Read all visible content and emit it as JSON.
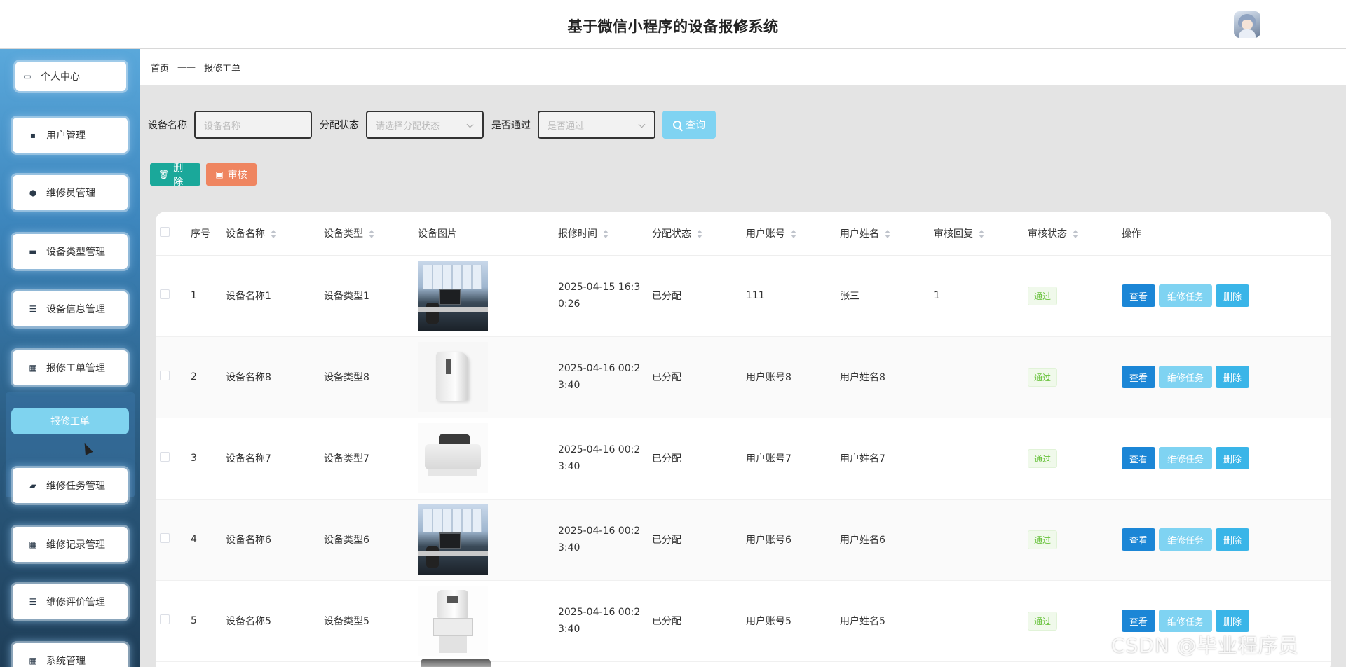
{
  "header": {
    "title": "基于微信小程序的设备报修系统"
  },
  "sidebar": {
    "items": [
      {
        "label": "个人中心",
        "icon": "card-icon"
      },
      {
        "label": "用户管理",
        "icon": "chat-icon"
      },
      {
        "label": "维修员管理",
        "icon": "pin-icon"
      },
      {
        "label": "设备类型管理",
        "icon": "monitor-icon"
      },
      {
        "label": "设备信息管理",
        "icon": "list-icon"
      },
      {
        "label": "报修工单管理",
        "icon": "grid-icon"
      },
      {
        "label": "维修任务管理",
        "icon": "wallet-icon"
      },
      {
        "label": "维修记录管理",
        "icon": "grid-icon"
      },
      {
        "label": "维修评价管理",
        "icon": "list-icon"
      },
      {
        "label": "系统管理",
        "icon": "grid-icon"
      }
    ],
    "active_sub": "报修工单"
  },
  "breadcrumb": {
    "home": "首页",
    "sep": "——",
    "current": "报修工单"
  },
  "search": {
    "device_name_label": "设备名称",
    "device_name_placeholder": "设备名称",
    "assign_label": "分配状态",
    "assign_placeholder": "请选择分配状态",
    "pass_label": "是否通过",
    "pass_placeholder": "是否通过",
    "query_label": "查询"
  },
  "actions": {
    "delete_label": "删除",
    "audit_label": "审核"
  },
  "table": {
    "headers": {
      "index": "序号",
      "device_name": "设备名称",
      "device_type": "设备类型",
      "device_image": "设备图片",
      "report_time": "报修时间",
      "assign_status": "分配状态",
      "user_account": "用户账号",
      "user_name": "用户姓名",
      "audit_reply": "审核回复",
      "audit_status": "审核状态",
      "operations": "操作"
    },
    "op_labels": {
      "view": "查看",
      "task": "维修任务",
      "delete": "删除"
    },
    "rows": [
      {
        "index": "1",
        "device_name": "设备名称1",
        "device_type": "设备类型1",
        "image": "office",
        "report_time": "2025-04-15 16:30:26",
        "assign_status": "已分配",
        "user_account": "111",
        "user_name": "张三",
        "audit_reply": "1",
        "audit_status": "通过"
      },
      {
        "index": "2",
        "device_name": "设备名称8",
        "device_type": "设备类型8",
        "image": "white",
        "report_time": "2025-04-16 00:23:40",
        "assign_status": "已分配",
        "user_account": "用户账号8",
        "user_name": "用户姓名8",
        "audit_reply": "",
        "audit_status": "通过"
      },
      {
        "index": "3",
        "device_name": "设备名称7",
        "device_type": "设备类型7",
        "image": "counter",
        "report_time": "2025-04-16 00:23:40",
        "assign_status": "已分配",
        "user_account": "用户账号7",
        "user_name": "用户姓名7",
        "audit_reply": "",
        "audit_status": "通过"
      },
      {
        "index": "4",
        "device_name": "设备名称6",
        "device_type": "设备类型6",
        "image": "office",
        "report_time": "2025-04-16 00:23:40",
        "assign_status": "已分配",
        "user_account": "用户账号6",
        "user_name": "用户姓名6",
        "audit_reply": "",
        "audit_status": "通过"
      },
      {
        "index": "5",
        "device_name": "设备名称5",
        "device_type": "设备类型5",
        "image": "binder",
        "report_time": "2025-04-16 00:23:40",
        "assign_status": "已分配",
        "user_account": "用户账号5",
        "user_name": "用户姓名5",
        "audit_reply": "",
        "audit_status": "通过"
      }
    ]
  },
  "watermark": "CSDN @毕业程序员"
}
